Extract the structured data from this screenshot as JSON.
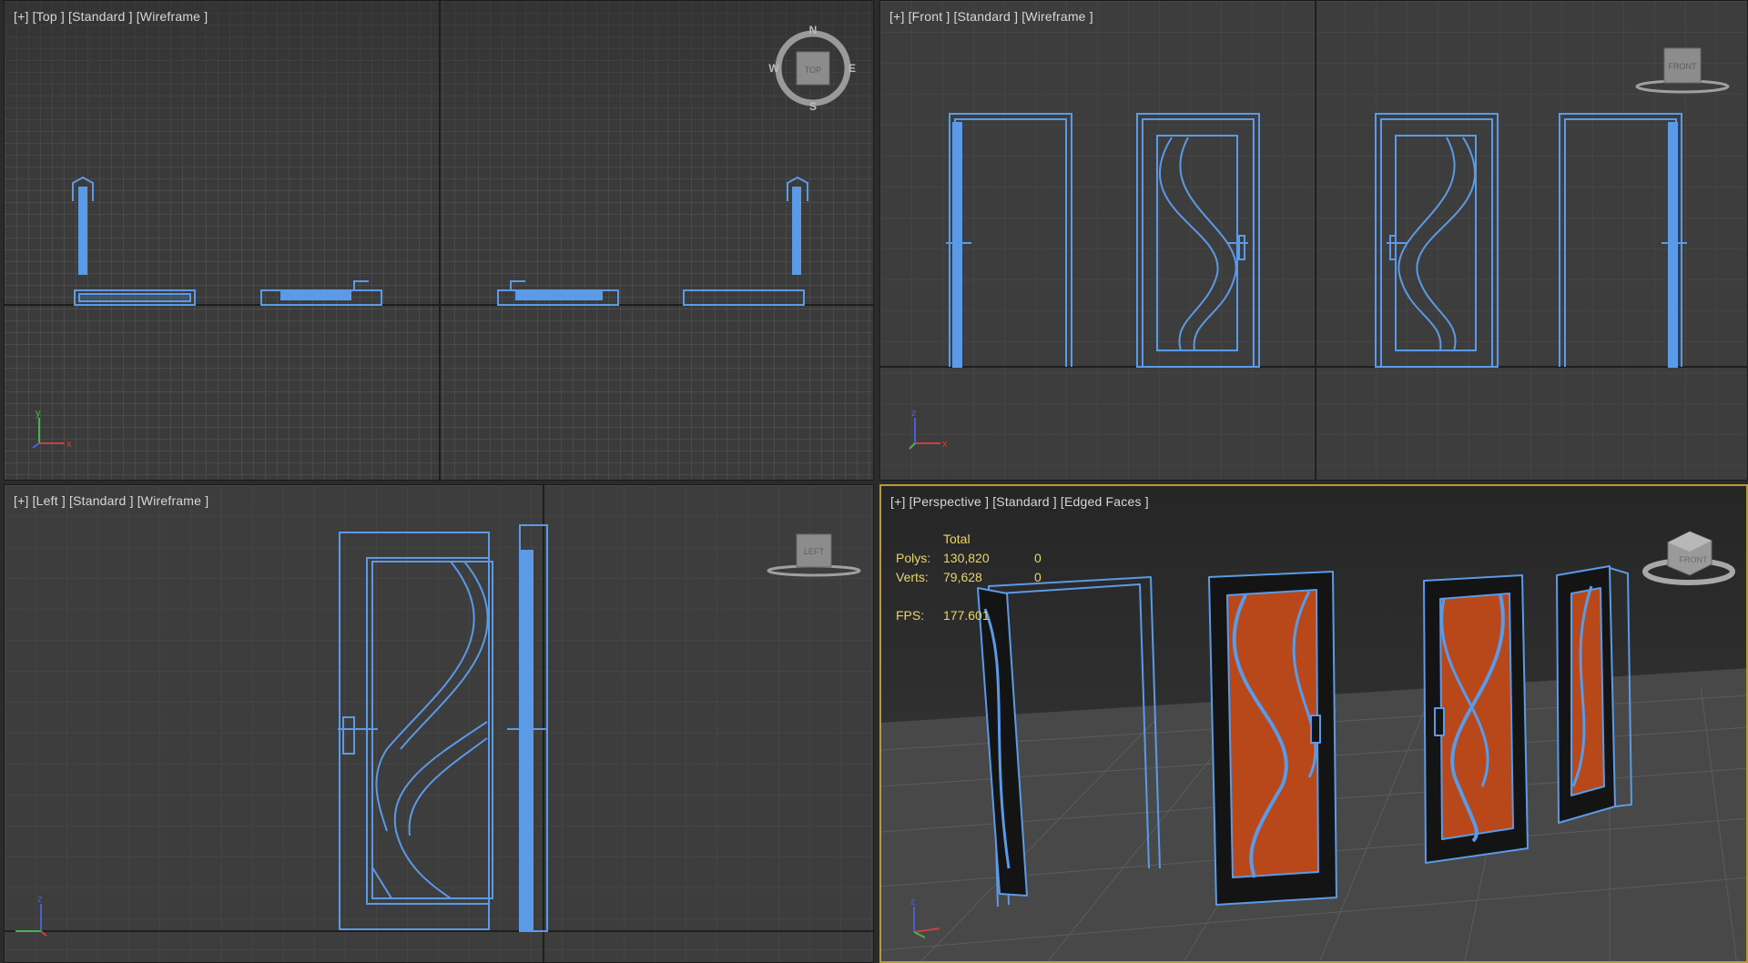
{
  "viewports": {
    "top": {
      "labels": [
        "[+]",
        "[Top ]",
        "[Standard ]",
        "[Wireframe ]"
      ],
      "viewcube": {
        "face": "TOP",
        "compass": {
          "n": "N",
          "s": "S",
          "e": "E",
          "w": "W"
        }
      }
    },
    "front": {
      "labels": [
        "[+]",
        "[Front ]",
        "[Standard ]",
        "[Wireframe ]"
      ],
      "viewcube": {
        "face": "FRONT"
      }
    },
    "left": {
      "labels": [
        "[+]",
        "[Left ]",
        "[Standard ]",
        "[Wireframe ]"
      ],
      "viewcube": {
        "face": "LEFT"
      }
    },
    "perspective": {
      "labels": [
        "[+]",
        "[Perspective ]",
        "[Standard ]",
        "[Edged Faces ]"
      ],
      "viewcube": {
        "face": "FRONT"
      },
      "stats": {
        "header": "Total",
        "polys_label": "Polys:",
        "polys_value": "130,820",
        "polys_sel": "0",
        "verts_label": "Verts:",
        "verts_value": "79,628",
        "verts_sel": "0",
        "fps_label": "FPS:",
        "fps_value": "177.601"
      }
    }
  },
  "axis_labels": {
    "x": "x",
    "y": "y",
    "z": "z"
  },
  "colors": {
    "wire": "#5b9ae6",
    "grid_light": "#555555",
    "grid_major": "#1e1e1e",
    "active_border": "#b59b3a",
    "stats_text": "#e8d66a",
    "door_panel": "#b8471a"
  }
}
